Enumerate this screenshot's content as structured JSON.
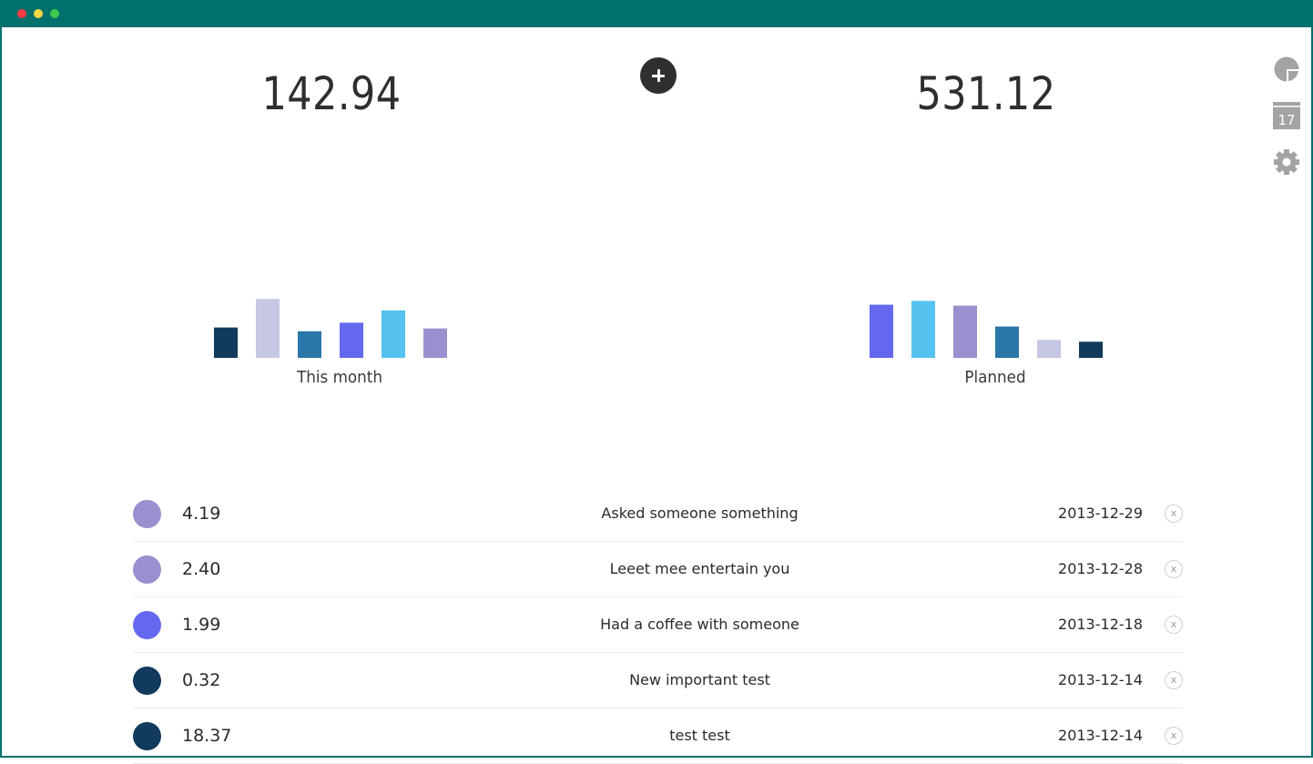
{
  "window": {
    "buttons": [
      "close",
      "minimize",
      "maximize"
    ]
  },
  "summary": {
    "this_month_total": "142.94",
    "planned_total": "531.12"
  },
  "sidebar": {
    "icons": [
      "pie-chart-icon",
      "calendar-icon",
      "gear-icon"
    ],
    "calendar_day": "17"
  },
  "chart_data": [
    {
      "type": "bar",
      "title": "This month",
      "values": [
        32,
        62,
        28,
        37,
        50,
        31
      ],
      "colors": [
        "#113a5c",
        "#c6c7e4",
        "#2b76a8",
        "#6468ee",
        "#56c2ef",
        "#9b8fcf"
      ],
      "ylim": [
        0,
        70
      ],
      "grid": false
    },
    {
      "type": "bar",
      "title": "Planned",
      "values": [
        56,
        60,
        55,
        33,
        19,
        17
      ],
      "colors": [
        "#6468ee",
        "#56c2ef",
        "#9b8fcf",
        "#2b76a8",
        "#c6c7e4",
        "#113a5c"
      ],
      "ylim": [
        0,
        70
      ],
      "grid": false
    }
  ],
  "transactions": [
    {
      "amount": "4.19",
      "description": "Asked someone something",
      "date": "2013-12-29",
      "color": "#9b8fcf",
      "remove": "x"
    },
    {
      "amount": "2.40",
      "description": "Leeet mee entertain you",
      "date": "2013-12-28",
      "color": "#9b8fcf",
      "remove": "x"
    },
    {
      "amount": "1.99",
      "description": "Had a coffee with someone",
      "date": "2013-12-18",
      "color": "#6468ee",
      "remove": "x"
    },
    {
      "amount": "0.32",
      "description": "New important test",
      "date": "2013-12-14",
      "color": "#113a5c",
      "remove": "x"
    },
    {
      "amount": "18.37",
      "description": "test test",
      "date": "2013-12-14",
      "color": "#113a5c",
      "remove": "x"
    }
  ]
}
